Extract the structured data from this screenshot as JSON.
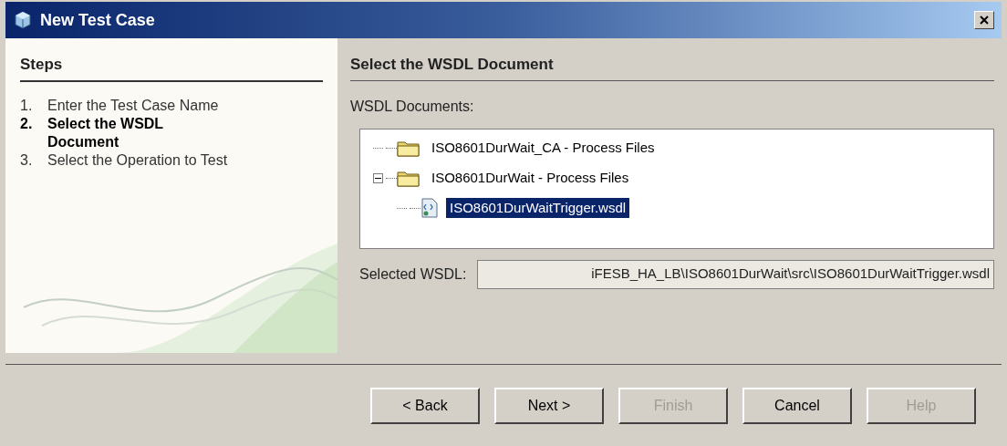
{
  "window": {
    "title": "New Test Case"
  },
  "steps": {
    "heading": "Steps",
    "items": [
      {
        "number": "1.",
        "label": "Enter the Test Case Name",
        "selected": false
      },
      {
        "number": "2.",
        "label": "Select the WSDL Document",
        "selected": true
      },
      {
        "number": "3.",
        "label": "Select the Operation to Test",
        "selected": false
      }
    ]
  },
  "panel": {
    "heading": "Select the WSDL Document",
    "tree_label": "WSDL Documents:",
    "tree": [
      {
        "kind": "folder",
        "label": "ISO8601DurWait_CA - Process Files",
        "selected": false
      },
      {
        "kind": "folder",
        "label": "ISO8601DurWait - Process Files",
        "selected": false,
        "expanded": true,
        "children": [
          {
            "kind": "wsdl",
            "label": "ISO8601DurWaitTrigger.wsdl",
            "selected": true
          }
        ]
      }
    ],
    "selected_label": "Selected WSDL:",
    "selected_value": "iFESB_HA_LB\\ISO8601DurWait\\src\\ISO8601DurWaitTrigger.wsdl"
  },
  "buttons": [
    {
      "label": "< Back",
      "disabled": false
    },
    {
      "label": "Next >",
      "disabled": false
    },
    {
      "label": "Finish",
      "disabled": true
    },
    {
      "label": "Cancel",
      "disabled": false
    },
    {
      "label": "Help",
      "disabled": true
    }
  ]
}
